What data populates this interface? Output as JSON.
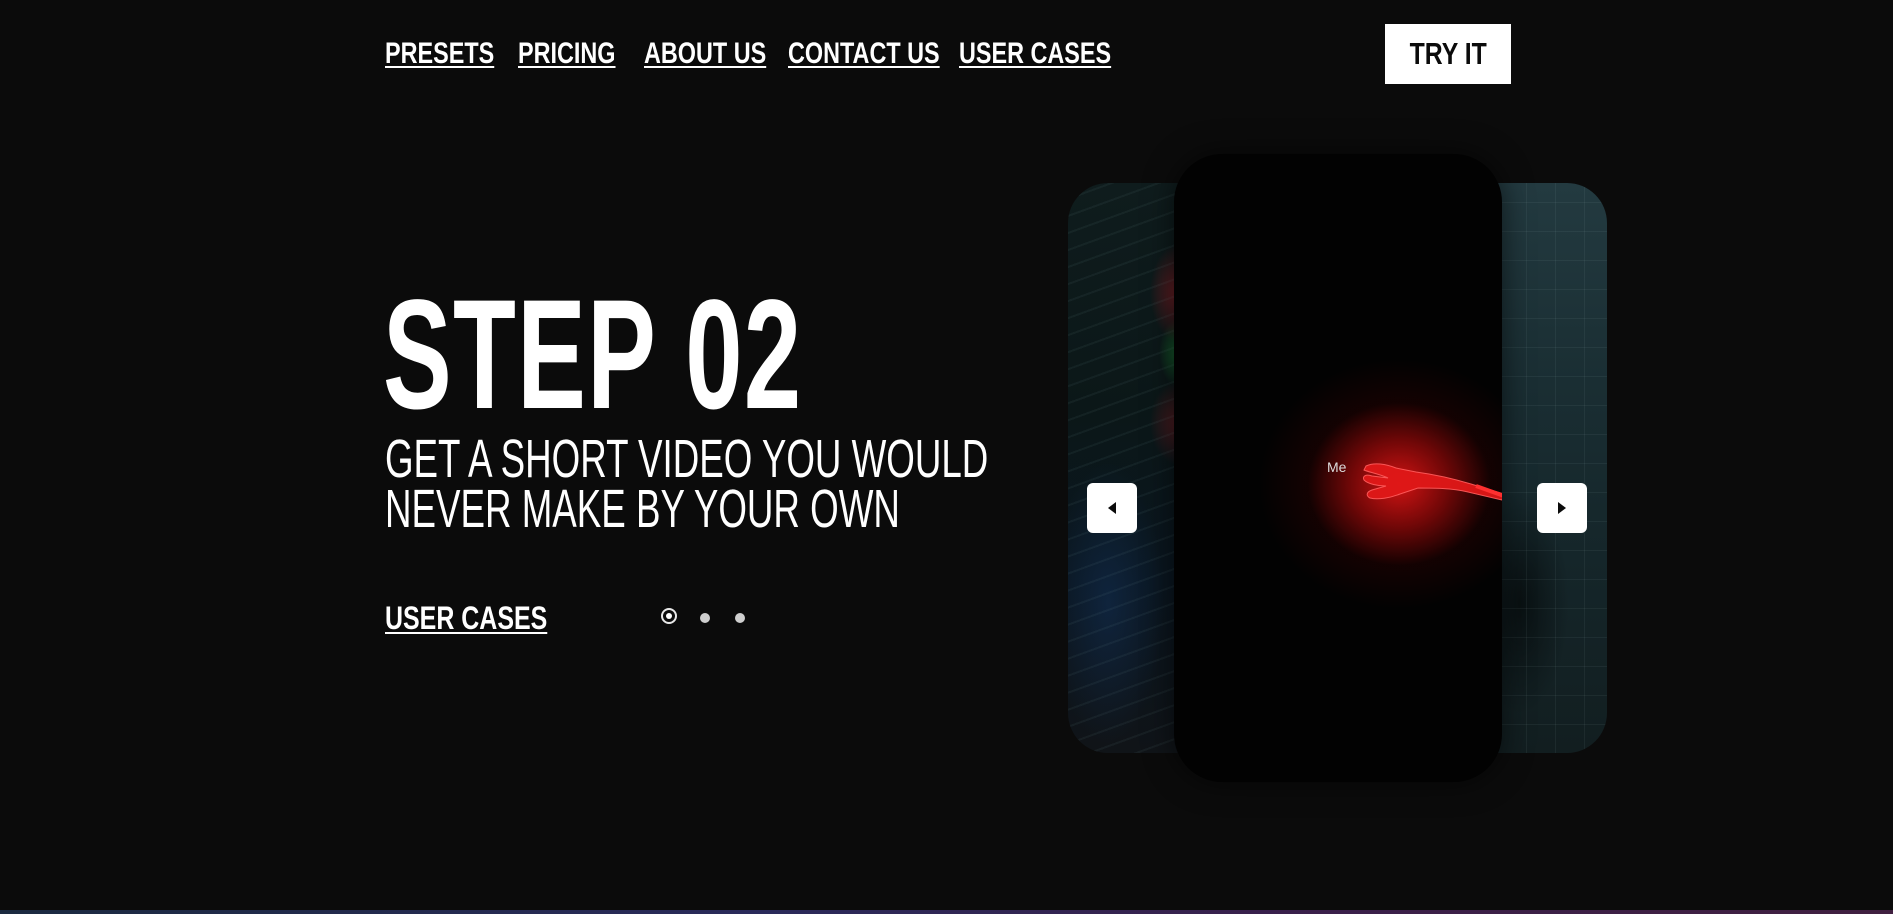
{
  "nav": {
    "items": [
      {
        "label": "PRESETS"
      },
      {
        "label": "PRICING"
      },
      {
        "label": "ABOUT US"
      },
      {
        "label": "CONTACT US"
      },
      {
        "label": "USER CASES"
      }
    ],
    "cta_label": "TRY IT"
  },
  "hero": {
    "title": "STEP 02",
    "subtitle_line1": "GET A SHORT VIDEO YOU WOULD",
    "subtitle_line2": "NEVER MAKE BY YOUR OWN",
    "link_label": "USER CASES",
    "pagination": {
      "total": 3,
      "active": 1
    }
  },
  "carousel": {
    "center_caption": "Me",
    "prev_icon": "caret-left-icon",
    "next_icon": "caret-right-icon"
  },
  "colors": {
    "background": "#0b0b0b",
    "text": "#ffffff",
    "accent_red": "#d81414"
  }
}
